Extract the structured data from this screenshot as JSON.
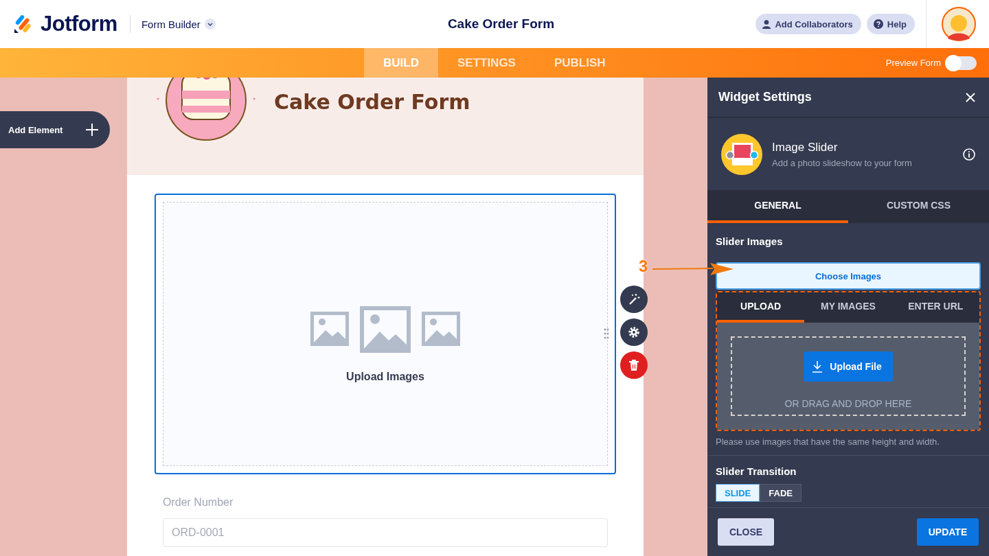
{
  "header": {
    "logo": "Jotform",
    "builder_menu": "Form Builder",
    "form_title": "Cake Order Form",
    "buttons": [
      {
        "label": "Add Collaborators",
        "kind": "collaborators"
      },
      {
        "label": "Help",
        "kind": "help"
      }
    ]
  },
  "nav": {
    "tabs": [
      {
        "label": "BUILD",
        "selected": true
      },
      {
        "label": "SETTINGS",
        "selected": false
      },
      {
        "label": "PUBLISH",
        "selected": false
      }
    ],
    "preview": {
      "label": "Preview Form",
      "on": false
    }
  },
  "add_element": "Add Element",
  "form": {
    "title": "Cake Order Form",
    "widget": {
      "label": "Upload Images",
      "selected": true
    },
    "fields": [
      {
        "label": "Order Number",
        "placeholder": "ORD-0001"
      }
    ]
  },
  "callout": "3",
  "panel": {
    "title": "Widget Settings",
    "widget_name": "Image Slider",
    "widget_desc": "Add a photo slideshow to your form",
    "tabs": [
      {
        "label": "GENERAL",
        "selected": true
      },
      {
        "label": "CUSTOM CSS",
        "selected": false
      }
    ],
    "slider_images": {
      "heading": "Slider Images",
      "choose": "Choose Images",
      "source_tabs": [
        {
          "label": "UPLOAD",
          "selected": true
        },
        {
          "label": "MY IMAGES",
          "selected": false
        },
        {
          "label": "ENTER URL",
          "selected": false
        }
      ],
      "upload_button": "Upload File",
      "drop_text": "OR DRAG AND DROP HERE",
      "hint": "Please use images that have the same height and width."
    },
    "transition": {
      "heading": "Slider Transition",
      "options": [
        {
          "label": "SLIDE",
          "selected": true
        },
        {
          "label": "FADE",
          "selected": false
        }
      ]
    },
    "close": "CLOSE",
    "update": "UPDATE"
  }
}
